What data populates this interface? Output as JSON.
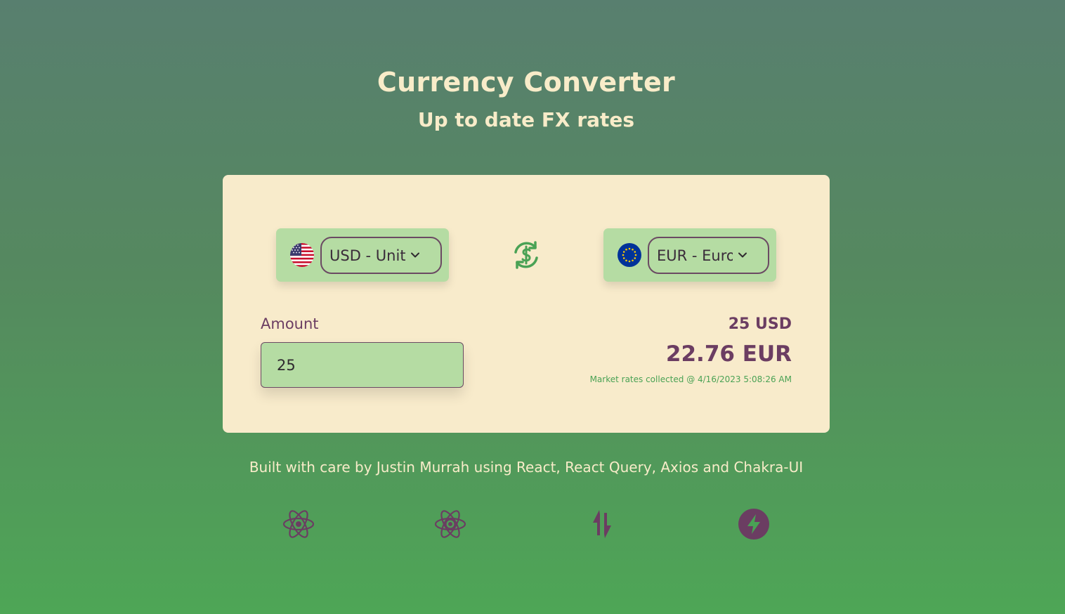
{
  "header": {
    "title": "Currency Converter",
    "subtitle": "Up to date FX rates"
  },
  "converter": {
    "from": {
      "flag_icon": "us-flag-icon",
      "selected": "USD - United States Dollar"
    },
    "to": {
      "flag_icon": "eu-flag-icon",
      "selected": "EUR - Euro"
    },
    "swap_icon": "currency-exchange-icon",
    "amount_label": "Amount",
    "amount_value": "25",
    "result": {
      "from_text": "25 USD",
      "to_text": "22.76 EUR",
      "note": "Market rates collected @ 4/16/2023 5:08:26 AM"
    }
  },
  "footer": {
    "credit": "Built with care by Justin Murrah using React, React Query, Axios and Chakra-UI",
    "icons": [
      "react-icon",
      "react-query-icon",
      "axios-icon",
      "chakra-ui-icon"
    ]
  },
  "colors": {
    "accent": "#6b3d62",
    "card_bg": "#f8ebcb",
    "field_bg": "#b5dca3",
    "green": "#4aa255",
    "cream": "#f8ecc9"
  }
}
